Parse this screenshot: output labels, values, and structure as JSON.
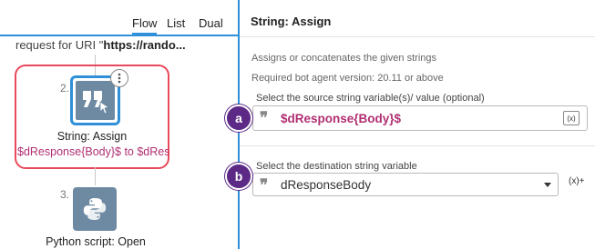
{
  "flow_panel": {
    "tabs": [
      {
        "label": "Flow",
        "active": true
      },
      {
        "label": "List",
        "active": false
      },
      {
        "label": "Dual",
        "active": false
      }
    ],
    "request_prefix": "request for URI \"",
    "request_bold": "https://rando...",
    "steps": [
      {
        "number": "2.",
        "title": "String: Assign",
        "description": "$dResponse{Body}$ to $dRes...",
        "icon": "quote-icon",
        "selected": true
      },
      {
        "number": "3.",
        "title": "Python script: Open",
        "icon": "python-icon"
      }
    ]
  },
  "properties": {
    "title": "String: Assign",
    "description": "Assigns or concatenates the given strings",
    "version_note": "Required bot agent version: 20.11 or above",
    "source": {
      "label": "Select the source string variable(s)/ value (optional)",
      "value": "$dResponse{Body}$",
      "var_button": "(x)"
    },
    "destination": {
      "label": "Select the destination string variable",
      "value": "dResponseBody",
      "var_button": "(x)+"
    }
  },
  "callouts": [
    "a",
    "b"
  ],
  "colors": {
    "accent_blue": "#2f8fd8",
    "highlight_red": "#e8495b",
    "variable_magenta": "#b02f72",
    "callout_purple": "#5c2a86",
    "icon_slate": "#6e8aa3"
  }
}
